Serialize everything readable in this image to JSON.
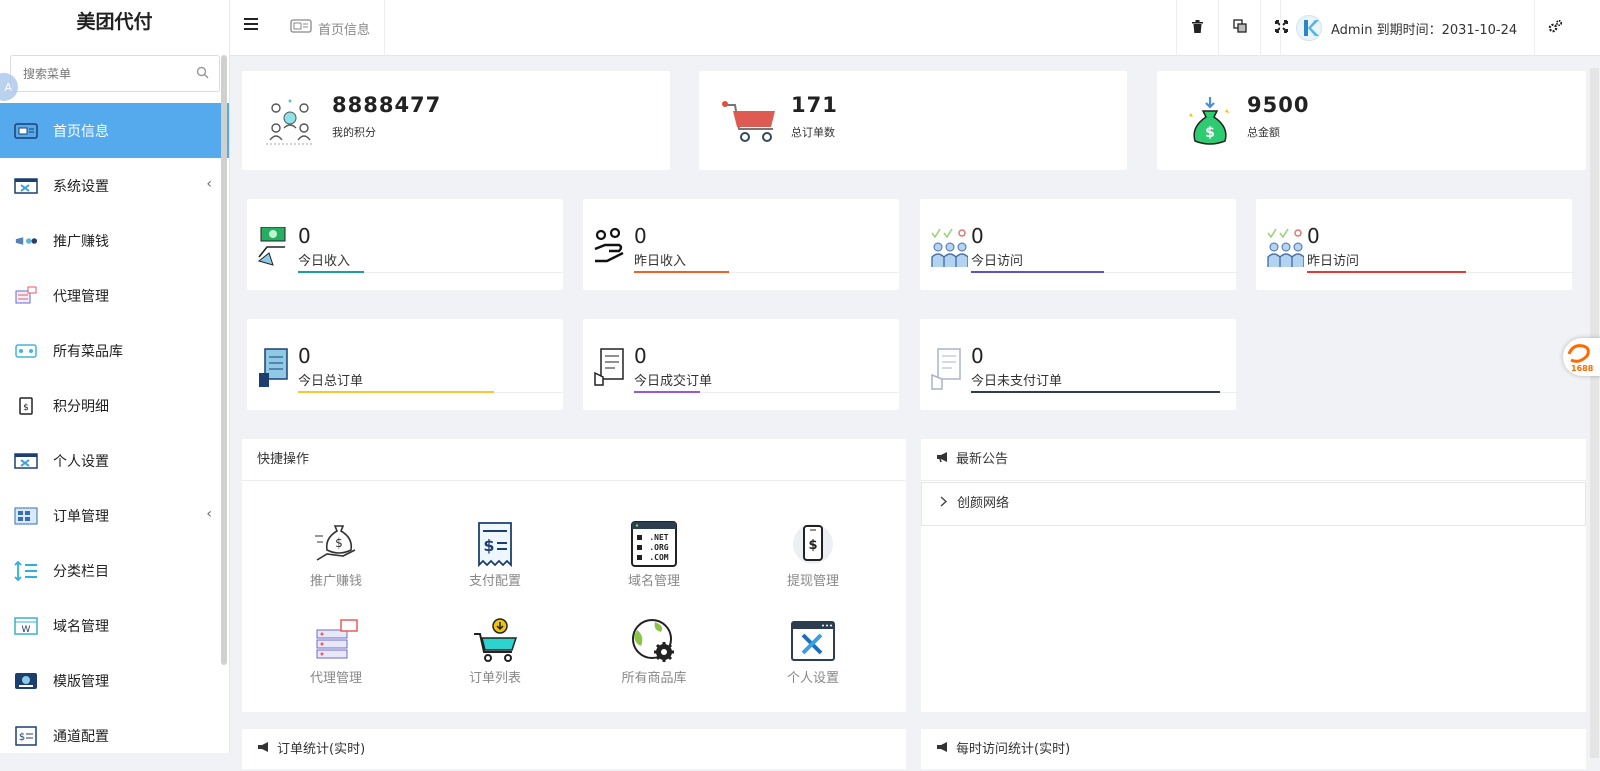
{
  "app": {
    "brand": "美团代付"
  },
  "sidebar": {
    "search_placeholder": "搜索菜单",
    "items": [
      {
        "label": "首页信息",
        "icon": "dashboard-icon",
        "active": true
      },
      {
        "label": "系统设置",
        "icon": "tools-icon",
        "has_arrow": true
      },
      {
        "label": "推广赚钱",
        "icon": "megaphone-icon"
      },
      {
        "label": "代理管理",
        "icon": "agent-icon"
      },
      {
        "label": "所有菜品库",
        "icon": "dish-library-icon"
      },
      {
        "label": "积分明细",
        "icon": "points-icon"
      },
      {
        "label": "个人设置",
        "icon": "personal-settings-icon"
      },
      {
        "label": "订单管理",
        "icon": "order-icon",
        "has_arrow": true
      },
      {
        "label": "分类栏目",
        "icon": "category-icon"
      },
      {
        "label": "域名管理",
        "icon": "domain-icon"
      },
      {
        "label": "模版管理",
        "icon": "template-icon"
      },
      {
        "label": "通道配置",
        "icon": "channel-icon"
      }
    ],
    "arrow_glyph": "‹"
  },
  "header": {
    "breadcrumb": "首页信息",
    "user_text": "Admin 到期时间：2031-10-24",
    "icons": [
      "trash-icon",
      "translate-icon",
      "fullscreen-icon",
      "settings-icon"
    ]
  },
  "stats_top": [
    {
      "value": "8888477",
      "label": "我的积分",
      "icon": "team-icon"
    },
    {
      "value": "171",
      "label": "总订单数",
      "icon": "cart-icon"
    },
    {
      "value": "9500",
      "label": "总金额",
      "icon": "money-bag-icon"
    }
  ],
  "stats_small": [
    {
      "value": "0",
      "label": "今日收入",
      "icon": "cash-hand-icon",
      "bar": 0.25,
      "color": "#1aa094"
    },
    {
      "value": "0",
      "label": "昨日收入",
      "icon": "coins-hand-icon",
      "bar": 0.36,
      "color": "#f25e2a"
    },
    {
      "value": "0",
      "label": "今日访问",
      "icon": "visitors-icon",
      "bar": 0.5,
      "color": "#5a53c9"
    },
    {
      "value": "0",
      "label": "昨日访问",
      "icon": "visitors-icon",
      "bar": 0.6,
      "color": "#e53935"
    },
    {
      "value": "0",
      "label": "今日总订单",
      "icon": "order-doc-icon",
      "bar": 0.74,
      "color": "#fbc531"
    },
    {
      "value": "0",
      "label": "今日成交订单",
      "icon": "deal-doc-icon",
      "bar": 0.25,
      "color": "#9b59d0"
    },
    {
      "value": "0",
      "label": "今日未支付订单",
      "icon": "unpaid-doc-icon",
      "bar": 0.94,
      "color": "#2c3e50"
    }
  ],
  "quick_ops": {
    "title": "快捷操作",
    "items": [
      {
        "label": "推广赚钱",
        "icon": "money-hand-icon"
      },
      {
        "label": "支付配置",
        "icon": "receipt-icon"
      },
      {
        "label": "域名管理",
        "icon": "domain-net-icon"
      },
      {
        "label": "提现管理",
        "icon": "phone-dollar-icon"
      },
      {
        "label": "代理管理",
        "icon": "server-icon"
      },
      {
        "label": "订单列表",
        "icon": "cart-download-icon"
      },
      {
        "label": "所有商品库",
        "icon": "globe-gear-icon"
      },
      {
        "label": "个人设置",
        "icon": "window-tools-icon"
      }
    ]
  },
  "notice": {
    "title": "最新公告",
    "items": [
      "创颜网络"
    ]
  },
  "bottom_panels": {
    "left": "订单统计(实时)",
    "right": "每时访问统计(实时)"
  },
  "badge": "1688"
}
